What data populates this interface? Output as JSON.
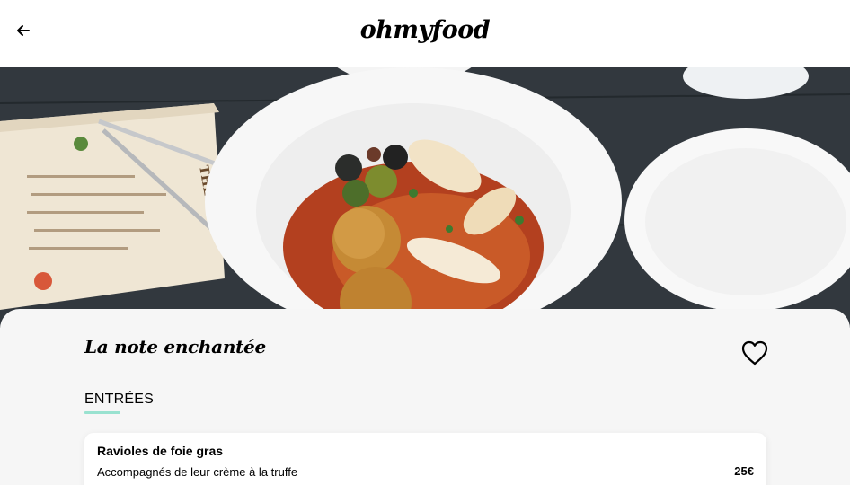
{
  "header": {
    "logo": "ohmyfood",
    "back_icon": "arrow-left-icon"
  },
  "hero": {
    "image": "food-photo"
  },
  "restaurant": {
    "name": "La note enchantée",
    "favorite_icon": "heart-icon"
  },
  "menu": {
    "section_title": "ENTRÉES",
    "accent_color": "#99e2d0",
    "items": [
      {
        "name": "Ravioles de foie gras",
        "description": "Accompagnés de leur crème à la truffe",
        "price": "25€"
      }
    ]
  }
}
